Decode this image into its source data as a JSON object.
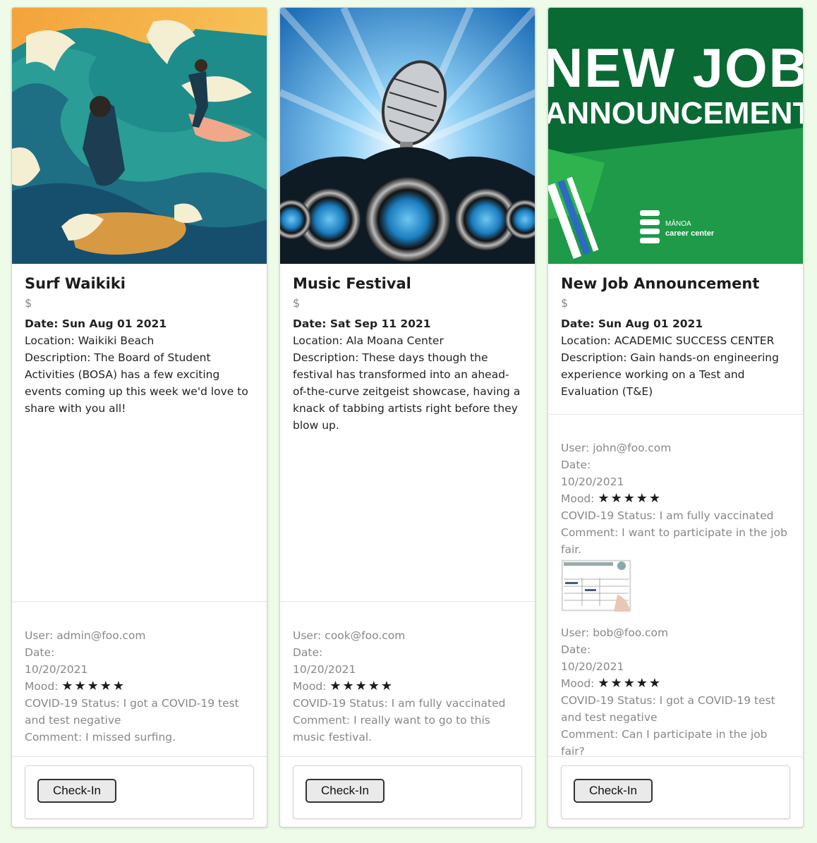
{
  "cards": [
    {
      "title": "Surf Waikiki",
      "price": "$",
      "date_label": "Date: Sun Aug 01 2021",
      "location": "Location: Waikiki Beach",
      "description": "Description: The Board of Student Activities (BOSA) has a few exciting events coming up this week we'd love to share with you all!",
      "notes": [
        {
          "user": "User: admin@foo.com",
          "date_label": "Date:",
          "date": "10/20/2021",
          "mood_label": "Mood:",
          "mood_stars": 5,
          "covid": "COVID-19 Status: I got a COVID-19 test and test negative",
          "comment": "Comment: I missed surfing."
        }
      ],
      "button": "Check-In"
    },
    {
      "title": "Music Festival",
      "price": "$",
      "date_label": "Date: Sat Sep 11 2021",
      "location": "Location: Ala Moana Center",
      "description": "Description: These days though the festival has transformed into an ahead-of-the-curve zeitgeist showcase, having a knack of tabbing artists right before they blow up.",
      "notes": [
        {
          "user": "User: cook@foo.com",
          "date_label": "Date:",
          "date": "10/20/2021",
          "mood_label": "Mood:",
          "mood_stars": 5,
          "covid": "COVID-19 Status: I am fully vaccinated",
          "comment": "Comment: I really want to go to this music festival."
        }
      ],
      "button": "Check-In"
    },
    {
      "title": "New Job Announcement",
      "price": "$",
      "date_label": "Date: Sun Aug 01 2021",
      "location": "Location: ACADEMIC SUCCESS CENTER",
      "description": "Description: Gain hands-on engineering experience working on a Test and Evaluation (T&E)",
      "image_text": [
        "NEW JOB",
        "ANNOUNCEMENT",
        "MĀNOA",
        "career center"
      ],
      "notes": [
        {
          "user": "User: john@foo.com",
          "date_label": "Date:",
          "date": "10/20/2021",
          "mood_label": "Mood:",
          "mood_stars": 5,
          "covid": "COVID-19 Status: I am fully vaccinated",
          "comment": "Comment: I want to participate in the job fair.",
          "photo": "vaccination-record-card"
        },
        {
          "user": "User: bob@foo.com",
          "date_label": "Date:",
          "date": "10/20/2021",
          "mood_label": "Mood:",
          "mood_stars": 5,
          "covid": "COVID-19 Status: I got a COVID-19 test and test negative",
          "comment": "Comment: Can I participate in the job fair?"
        }
      ],
      "button": "Check-In"
    }
  ],
  "stars_glyph": "★★★★★"
}
